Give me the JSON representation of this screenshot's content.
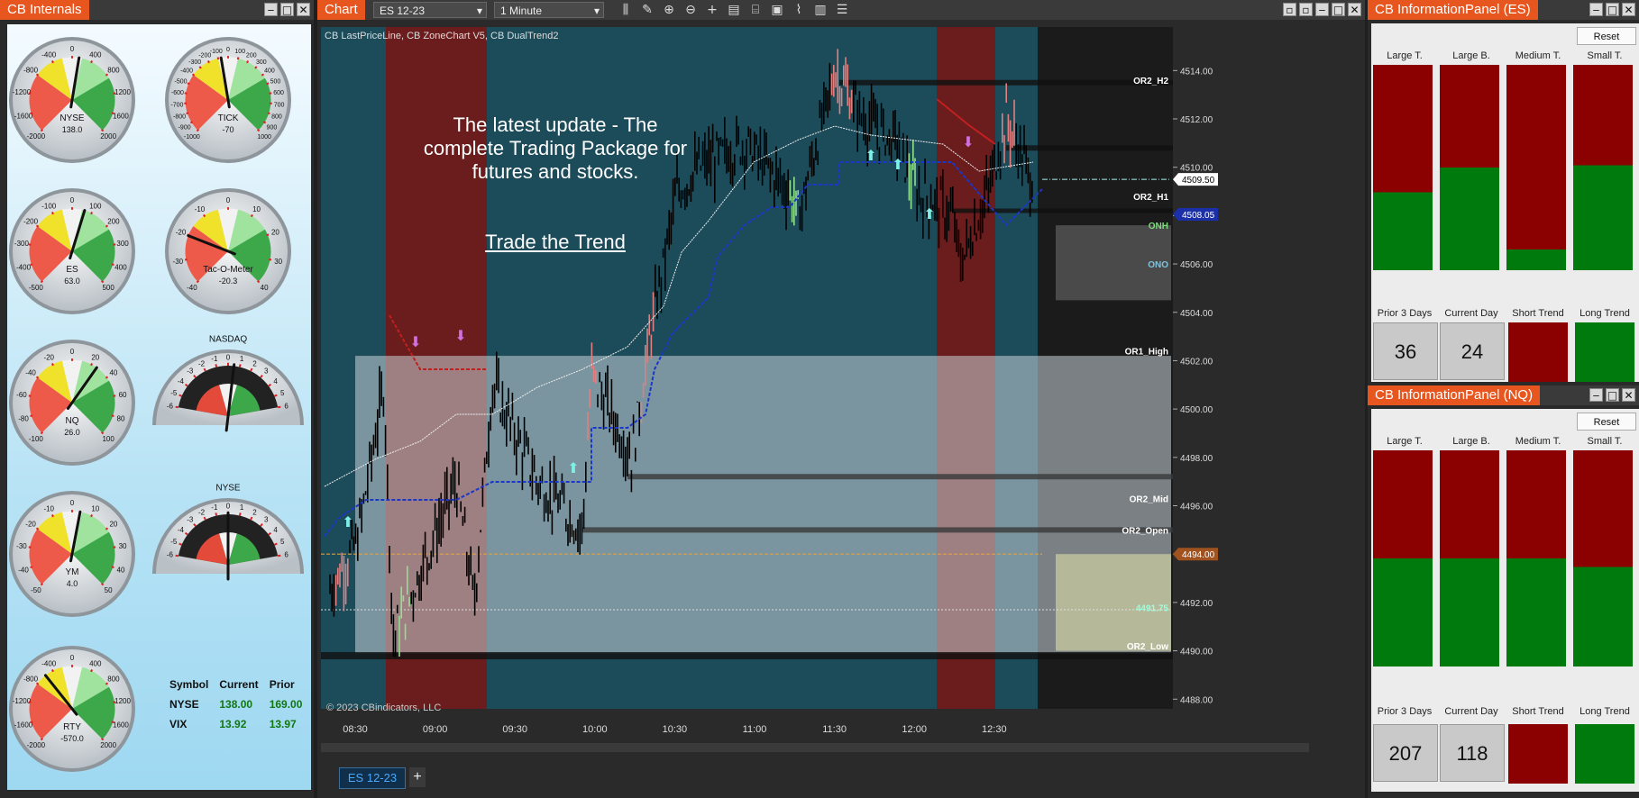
{
  "internals": {
    "title": "CB Internals",
    "gauges": [
      {
        "name": "NYSE",
        "value": "138.0",
        "min": -2000,
        "max": 2000,
        "needle": 138,
        "ticks": [
          "-2000",
          "-1600",
          "-1200",
          "-800",
          "-400",
          "0",
          "400",
          "800",
          "1200",
          "1600",
          "2000"
        ]
      },
      {
        "name": "TICK",
        "value": "-70",
        "min": -1000,
        "max": 1000,
        "needle": -70,
        "ticks": [
          "-1000",
          "-900",
          "-800",
          "-700",
          "-600",
          "-500",
          "-400",
          "-300",
          "-200",
          "-100",
          "0",
          "100",
          "200",
          "300",
          "400",
          "500",
          "600",
          "700",
          "800",
          "900",
          "1000"
        ]
      },
      {
        "name": "ES",
        "value": "63.0",
        "min": -500,
        "max": 500,
        "needle": 63,
        "ticks": [
          "-500",
          "-400",
          "-300",
          "-200",
          "-100",
          "0",
          "100",
          "200",
          "300",
          "400",
          "500"
        ]
      },
      {
        "name": "Tac-O-Meter",
        "value": "-20.3",
        "min": -40,
        "max": 40,
        "needle": -20.3,
        "ticks": [
          "-40",
          "-30",
          "-20",
          "-10",
          "0",
          "10",
          "20",
          "30",
          "40"
        ]
      },
      {
        "name": "NQ",
        "value": "26.0",
        "min": -100,
        "max": 100,
        "needle": 26,
        "ticks": [
          "-100",
          "-80",
          "-60",
          "-40",
          "-20",
          "0",
          "20",
          "40",
          "60",
          "80",
          "100"
        ]
      },
      {
        "name": "NASDAQ",
        "value": "",
        "min": -6,
        "max": 6,
        "needle": 0.5,
        "ticks": [
          "-6",
          "-5",
          "-4",
          "-3",
          "-2",
          "-1",
          "0",
          "1",
          "2",
          "3",
          "4",
          "5",
          "6"
        ]
      },
      {
        "name": "YM",
        "value": "4.0",
        "min": -50,
        "max": 50,
        "needle": 4,
        "ticks": [
          "-50",
          "-40",
          "-30",
          "-20",
          "-10",
          "0",
          "10",
          "20",
          "30",
          "40",
          "50"
        ]
      },
      {
        "name": "NYSE",
        "value": "",
        "min": -6,
        "max": 6,
        "needle": 0,
        "ticks": [
          "-6",
          "-5",
          "-4",
          "-3",
          "-2",
          "-1",
          "0",
          "1",
          "2",
          "3",
          "4",
          "5",
          "6"
        ]
      },
      {
        "name": "RTY",
        "value": "-570.0",
        "min": -2000,
        "max": 2000,
        "needle": -570,
        "ticks": [
          "-2000",
          "-1600",
          "-1200",
          "-800",
          "-400",
          "0",
          "400",
          "800",
          "1200",
          "1600",
          "2000"
        ]
      }
    ],
    "table": {
      "headers": [
        "Symbol",
        "Current",
        "Prior"
      ],
      "rows": [
        [
          "NYSE",
          "138.00",
          "169.00"
        ],
        [
          "VIX",
          "13.92",
          "13.97"
        ]
      ]
    }
  },
  "chart": {
    "title": "Chart",
    "instrument": "ES 12-23",
    "interval": "1 Minute",
    "indicators": "CB LastPriceLine, CB ZoneChart V5, CB DualTrend2",
    "note_lines": [
      "The latest update - The",
      "complete Trading Package for",
      "futures and stocks."
    ],
    "note_link": "Trade the Trend",
    "copyright": "© 2023 CBindicators, LLC",
    "tab": "ES 12-23",
    "x_labels": [
      "08:30",
      "09:00",
      "09:30",
      "10:00",
      "10:30",
      "11:00",
      "11:30",
      "12:00",
      "12:30"
    ],
    "y_labels": [
      "4514.00",
      "4512.00",
      "4510.00",
      "4508.00",
      "4506.00",
      "4504.00",
      "4502.00",
      "4500.00",
      "4498.00",
      "4496.00",
      "4494.00",
      "4492.00",
      "4490.00",
      "4488.00"
    ],
    "price_markers": [
      {
        "label": "4509.50",
        "color": "#ffffff",
        "text": "#000000"
      },
      {
        "label": "4508.05",
        "color": "#1b2fa8",
        "text": "#ffffff"
      },
      {
        "label": "4494.00",
        "color": "#a0521f",
        "text": "#ffffff"
      }
    ],
    "level_labels": [
      "OR2_H2",
      "OR2_H1",
      "ONH",
      "ONO",
      "OR1_High",
      "OR2_Mid",
      "OR2_Open",
      "4491.75",
      "OR2_Low"
    ],
    "colors": {
      "teal": "#1b4a5a",
      "red": "#6b1c1c",
      "candle": "#000000",
      "up": "#90e090",
      "down": "#e08080"
    }
  },
  "panels": [
    {
      "title": "CB InformationPanel (ES)",
      "reset": "Reset",
      "headers": [
        "Large T.",
        "Large B.",
        "Medium T.",
        "Small T."
      ],
      "red_fraction": [
        0.62,
        0.5,
        0.9,
        0.49
      ],
      "labels": [
        "Prior 3 Days",
        "Current Day",
        "Short Trend",
        "Long Trend"
      ],
      "values": [
        "36",
        "24"
      ],
      "trend_colors": [
        "#8b0000",
        "#007a0d"
      ]
    },
    {
      "title": "CB InformationPanel (NQ)",
      "reset": "Reset",
      "headers": [
        "Large T.",
        "Large B.",
        "Medium T.",
        "Small T."
      ],
      "red_fraction": [
        0.5,
        0.5,
        0.5,
        0.54
      ],
      "labels": [
        "Prior 3 Days",
        "Current Day",
        "Short Trend",
        "Long Trend"
      ],
      "values": [
        "207",
        "118"
      ],
      "trend_colors": [
        "#8b0000",
        "#007a0d"
      ]
    }
  ]
}
